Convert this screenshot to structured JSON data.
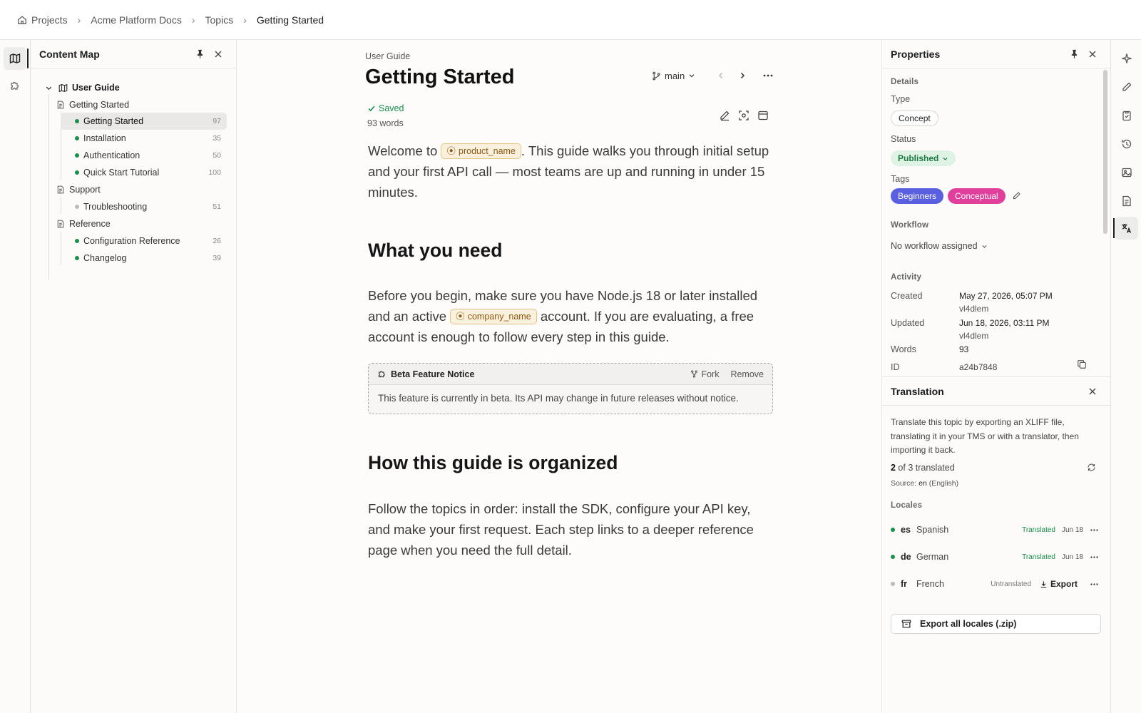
{
  "breadcrumb": [
    "Projects",
    "Acme Platform Docs",
    "Topics",
    "Getting Started"
  ],
  "content_map": {
    "title": "Content Map",
    "root": "User Guide",
    "groups": [
      {
        "label": "Getting Started",
        "items": [
          {
            "label": "Getting Started",
            "count": "97",
            "status": "green"
          },
          {
            "label": "Installation",
            "count": "35",
            "status": "green"
          },
          {
            "label": "Authentication",
            "count": "50",
            "status": "green"
          },
          {
            "label": "Quick Start Tutorial",
            "count": "100",
            "status": "green"
          }
        ]
      },
      {
        "label": "Support",
        "items": [
          {
            "label": "Troubleshooting",
            "count": "51",
            "status": "gray"
          }
        ]
      },
      {
        "label": "Reference",
        "items": [
          {
            "label": "Configuration Reference",
            "count": "26",
            "status": "green"
          },
          {
            "label": "Changelog",
            "count": "39",
            "status": "green"
          }
        ]
      }
    ]
  },
  "editor": {
    "kicker": "User Guide",
    "title": "Getting Started",
    "branch": "main",
    "saved": "Saved",
    "word_count": "93 words",
    "intro_a": "Welcome to",
    "var_product": "product_name",
    "intro_b": ". This guide walks you through initial setup and your first API call — most teams are up and running in under 15 minutes.",
    "h_need": "What you need",
    "need_a": "Before you begin, make sure you have Node.js 18 or later installed and an active",
    "var_company": "company_name",
    "need_b": "account. If you are evaluating, a free account is enough to follow every step in this guide.",
    "notice_title": "Beta Feature Notice",
    "notice_fork": "Fork",
    "notice_remove": "Remove",
    "notice_body": "This feature is currently in beta. Its API may change in future releases without notice.",
    "h_org": "How this guide is organized",
    "org_text": "Follow the topics in order: install the SDK, configure your API key, and make your first request. Each step links to a deeper reference page when you need the full detail."
  },
  "properties": {
    "title": "Properties",
    "details": "Details",
    "type_label": "Type",
    "type_value": "Concept",
    "status_label": "Status",
    "status_value": "Published",
    "tags_label": "Tags",
    "tags": [
      "Beginners",
      "Conceptual"
    ],
    "tag_colors": [
      "#5a5fe0",
      "#e0409b"
    ],
    "workflow_label": "Workflow",
    "workflow_value": "No workflow assigned",
    "activity_label": "Activity",
    "created_label": "Created",
    "created_value": "May 27, 2026, 05:07 PM",
    "created_by": "vl4dlem",
    "updated_label": "Updated",
    "updated_value": "Jun 18, 2026, 03:11 PM",
    "updated_by": "vl4dlem",
    "words_label": "Words",
    "words_value": "93",
    "id_label": "ID",
    "id_value": "a24b7848"
  },
  "translation": {
    "title": "Translation",
    "description": "Translate this topic by exporting an XLIFF file, translating it in your TMS or with a translator, then importing it back.",
    "progress_count": "2",
    "progress_text": " of 3 translated",
    "source_label": "Source: ",
    "source_code": "en",
    "source_name": " (English)",
    "locales_label": "Locales",
    "locales": [
      {
        "code": "es",
        "name": "Spanish",
        "status": "Translated",
        "date": "Jun 18"
      },
      {
        "code": "de",
        "name": "German",
        "status": "Translated",
        "date": "Jun 18"
      },
      {
        "code": "fr",
        "name": "French",
        "status": "Untranslated",
        "action": "Export"
      }
    ],
    "export_all": "Export all locales (.zip)"
  },
  "colors": {
    "accent_green": "#1a8f4a",
    "variable_bg": "#fbf0dc",
    "published_bg": "#dff3e4"
  }
}
